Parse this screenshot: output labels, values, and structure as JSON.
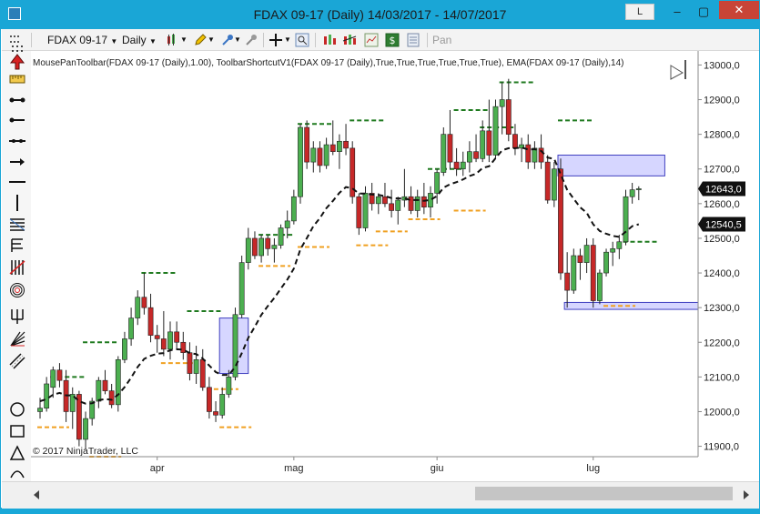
{
  "window": {
    "title": "FDAX 09-17 (Daily)  14/03/2017 - 14/07/2017",
    "link_label": "L",
    "minimize": "–",
    "restore": "▢",
    "close": "✕"
  },
  "toolbar": {
    "instrument": "FDAX 09-17",
    "interval": "Daily",
    "pan_label": "Pan"
  },
  "chart": {
    "indicator_label": "MousePanToolbar(FDAX 09-17 (Daily),1.00), ToolbarShortcutV1(FDAX 09-17 (Daily),True,True,True,True,True,True), EMA(FDAX 09-17 (Daily),14)",
    "copyright": "© 2017 NinjaTrader, LLC",
    "price_labels": [
      "13000,0",
      "12900,0",
      "12800,0",
      "12700,0",
      "12600,0",
      "12500,0",
      "12400,0",
      "12300,0",
      "12200,0",
      "12100,0",
      "12000,0",
      "11900,0"
    ],
    "price_values": [
      13000,
      12900,
      12800,
      12700,
      12600,
      12500,
      12400,
      12300,
      12200,
      12100,
      12000,
      11900
    ],
    "last_price_label": "12643,0",
    "last_price": 12643,
    "ema_price_label": "12540,5",
    "ema_price": 12540.5,
    "x_labels": [
      "apr",
      "mag",
      "giu",
      "lug"
    ],
    "colors": {
      "up": "#4caf50",
      "down": "#c62828",
      "ema": "#111111",
      "high_marker": "#1f7a1f",
      "low_marker": "#f0a020",
      "zone_fill": "#c8c8ff",
      "zone_stroke": "#4040c0"
    }
  },
  "chart_data": {
    "type": "candlestick",
    "ylim": [
      11870,
      13030
    ],
    "candles": [
      [
        12000,
        12040,
        11980,
        12010
      ],
      [
        12010,
        12100,
        12000,
        12080
      ],
      [
        12070,
        12130,
        12040,
        12120
      ],
      [
        12120,
        12140,
        12070,
        12090
      ],
      [
        12090,
        12120,
        11970,
        12000
      ],
      [
        12000,
        12070,
        11950,
        12050
      ],
      [
        12050,
        12060,
        11900,
        11920
      ],
      [
        11920,
        12000,
        11890,
        11980
      ],
      [
        11980,
        12040,
        11960,
        12030
      ],
      [
        12030,
        12100,
        12010,
        12090
      ],
      [
        12090,
        12120,
        12050,
        12060
      ],
      [
        12060,
        12080,
        12010,
        12020
      ],
      [
        12020,
        12160,
        12000,
        12150
      ],
      [
        12150,
        12230,
        12140,
        12210
      ],
      [
        12210,
        12300,
        12190,
        12270
      ],
      [
        12270,
        12350,
        12250,
        12330
      ],
      [
        12330,
        12400,
        12280,
        12300
      ],
      [
        12300,
        12340,
        12200,
        12220
      ],
      [
        12220,
        12250,
        12170,
        12210
      ],
      [
        12210,
        12290,
        12160,
        12180
      ],
      [
        12180,
        12260,
        12150,
        12230
      ],
      [
        12230,
        12260,
        12180,
        12200
      ],
      [
        12200,
        12230,
        12150,
        12170
      ],
      [
        12170,
        12200,
        12090,
        12110
      ],
      [
        12110,
        12190,
        12080,
        12150
      ],
      [
        12150,
        12180,
        12060,
        12070
      ],
      [
        12070,
        12100,
        11980,
        12000
      ],
      [
        12000,
        12030,
        11970,
        11990
      ],
      [
        11990,
        12070,
        11980,
        12050
      ],
      [
        12050,
        12120,
        12040,
        12100
      ],
      [
        12100,
        12300,
        12090,
        12280
      ],
      [
        12280,
        12450,
        12270,
        12430
      ],
      [
        12430,
        12530,
        12410,
        12500
      ],
      [
        12500,
        12520,
        12440,
        12450
      ],
      [
        12450,
        12510,
        12430,
        12500
      ],
      [
        12500,
        12510,
        12450,
        12470
      ],
      [
        12470,
        12500,
        12430,
        12480
      ],
      [
        12480,
        12540,
        12470,
        12530
      ],
      [
        12530,
        12580,
        12500,
        12550
      ],
      [
        12550,
        12640,
        12540,
        12620
      ],
      [
        12620,
        12830,
        12600,
        12820
      ],
      [
        12820,
        12840,
        12700,
        12720
      ],
      [
        12720,
        12780,
        12690,
        12760
      ],
      [
        12760,
        12780,
        12690,
        12710
      ],
      [
        12710,
        12790,
        12700,
        12770
      ],
      [
        12770,
        12840,
        12740,
        12750
      ],
      [
        12750,
        12800,
        12700,
        12780
      ],
      [
        12780,
        12830,
        12740,
        12760
      ],
      [
        12760,
        12780,
        12600,
        12620
      ],
      [
        12620,
        12630,
        12510,
        12530
      ],
      [
        12530,
        12650,
        12520,
        12630
      ],
      [
        12630,
        12660,
        12580,
        12600
      ],
      [
        12600,
        12630,
        12570,
        12620
      ],
      [
        12620,
        12660,
        12590,
        12600
      ],
      [
        12600,
        12640,
        12560,
        12580
      ],
      [
        12580,
        12620,
        12540,
        12610
      ],
      [
        12610,
        12700,
        12590,
        12620
      ],
      [
        12620,
        12650,
        12570,
        12580
      ],
      [
        12580,
        12640,
        12560,
        12620
      ],
      [
        12620,
        12660,
        12570,
        12590
      ],
      [
        12590,
        12650,
        12560,
        12630
      ],
      [
        12630,
        12700,
        12600,
        12690
      ],
      [
        12690,
        12820,
        12680,
        12800
      ],
      [
        12800,
        12870,
        12700,
        12720
      ],
      [
        12720,
        12760,
        12680,
        12700
      ],
      [
        12700,
        12750,
        12680,
        12720
      ],
      [
        12720,
        12780,
        12690,
        12750
      ],
      [
        12750,
        12800,
        12720,
        12730
      ],
      [
        12730,
        12840,
        12720,
        12810
      ],
      [
        12810,
        12900,
        12720,
        12740
      ],
      [
        12740,
        12900,
        12730,
        12880
      ],
      [
        12880,
        12950,
        12800,
        12900
      ],
      [
        12900,
        12960,
        12780,
        12800
      ],
      [
        12800,
        12830,
        12740,
        12760
      ],
      [
        12760,
        12790,
        12720,
        12770
      ],
      [
        12770,
        12800,
        12700,
        12720
      ],
      [
        12720,
        12780,
        12700,
        12760
      ],
      [
        12760,
        12800,
        12700,
        12720
      ],
      [
        12720,
        12740,
        12600,
        12610
      ],
      [
        12610,
        12720,
        12590,
        12700
      ],
      [
        12700,
        12730,
        12380,
        12400
      ],
      [
        12400,
        12460,
        12300,
        12350
      ],
      [
        12350,
        12470,
        12340,
        12450
      ],
      [
        12450,
        12470,
        12380,
        12430
      ],
      [
        12430,
        12500,
        12400,
        12480
      ],
      [
        12480,
        12500,
        12300,
        12320
      ],
      [
        12320,
        12410,
        12310,
        12400
      ],
      [
        12400,
        12470,
        12390,
        12460
      ],
      [
        12460,
        12490,
        12420,
        12470
      ],
      [
        12470,
        12510,
        12440,
        12490
      ],
      [
        12490,
        12640,
        12480,
        12620
      ],
      [
        12620,
        12660,
        12600,
        12640
      ],
      [
        12640,
        12650,
        12610,
        12643
      ]
    ],
    "ema": [
      12030,
      12036,
      12049,
      12054,
      12047,
      12047,
      12030,
      12023,
      12024,
      12033,
      12036,
      12034,
      12049,
      12071,
      12098,
      12129,
      12152,
      12161,
      12167,
      12169,
      12177,
      12180,
      12179,
      12169,
      12166,
      12153,
      12133,
      12114,
      12106,
      12106,
      12129,
      12169,
      12213,
      12245,
      12279,
      12305,
      12328,
      12355,
      12381,
      12413,
      12468,
      12501,
      12535,
      12558,
      12587,
      12608,
      12631,
      12648,
      12644,
      12629,
      12629,
      12626,
      12625,
      12622,
      12616,
      12615,
      12615,
      12610,
      12611,
      12608,
      12611,
      12622,
      12646,
      12656,
      12662,
      12670,
      12680,
      12686,
      12703,
      12708,
      12731,
      12754,
      12760,
      12760,
      12762,
      12756,
      12757,
      12752,
      12733,
      12729,
      12685,
      12640,
      12614,
      12589,
      12574,
      12540,
      12521,
      12513,
      12507,
      12504,
      12519,
      12535,
      12540.5
    ],
    "swing_highs": [
      [
        2,
        12100
      ],
      [
        7,
        12200
      ],
      [
        16,
        12400
      ],
      [
        23,
        12290
      ],
      [
        34,
        12510
      ],
      [
        40,
        12830
      ],
      [
        48,
        12840
      ],
      [
        60,
        12700
      ],
      [
        64,
        12870
      ],
      [
        68,
        12820
      ],
      [
        71,
        12950
      ],
      [
        80,
        12840
      ],
      [
        90,
        12490
      ]
    ],
    "swing_lows": [
      [
        0,
        11955
      ],
      [
        8,
        11870
      ],
      [
        19,
        12140
      ],
      [
        26,
        12065
      ],
      [
        28,
        11955
      ],
      [
        34,
        12420
      ],
      [
        40,
        12475
      ],
      [
        49,
        12480
      ],
      [
        52,
        12520
      ],
      [
        57,
        12555
      ],
      [
        64,
        12580
      ],
      [
        87,
        12305
      ]
    ],
    "zones": [
      {
        "from": 28,
        "to": 32,
        "low": 12110,
        "high": 12270
      },
      {
        "from": 80,
        "to": 96,
        "low": 12680,
        "high": 12740
      },
      {
        "from": 81,
        "to": 104,
        "low": 12295,
        "high": 12315
      }
    ]
  }
}
